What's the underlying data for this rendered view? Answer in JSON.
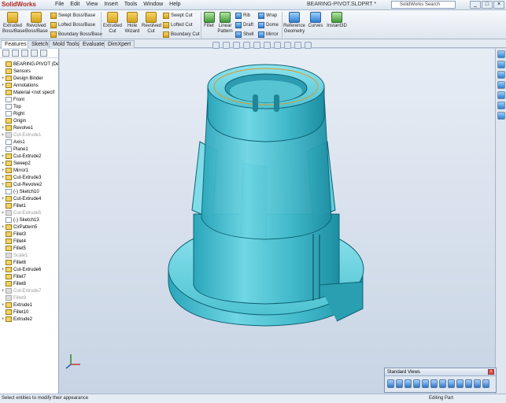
{
  "app": {
    "name": "SolidWorks",
    "filename": "BEARING-PIVOT.SLDPRT *",
    "search_placeholder": "SolidWorks Search"
  },
  "menu": [
    "File",
    "Edit",
    "View",
    "Insert",
    "Tools",
    "Window",
    "Help"
  ],
  "ribbon": {
    "extruded_boss": "Extruded Boss/Base",
    "revolved_boss": "Revolved Boss/Base",
    "swept_boss": "Swept Boss/Base",
    "lofted_boss": "Lofted Boss/Base",
    "boundary_boss": "Boundary Boss/Base",
    "extruded_cut": "Extruded Cut",
    "hole_wizard": "Hole Wizard",
    "revolved_cut": "Revolved Cut",
    "swept_cut": "Swept Cut",
    "lofted_cut": "Lofted Cut",
    "boundary_cut": "Boundary Cut",
    "fillet": "Fillet",
    "linear_pattern": "Linear Pattern",
    "rib": "Rib",
    "draft": "Draft",
    "shell": "Shell",
    "wrap": "Wrap",
    "dome": "Dome",
    "mirror": "Mirror",
    "reference_geometry": "Reference Geometry",
    "curves": "Curves",
    "instant3d": "Instant3D"
  },
  "tabs": [
    "Features",
    "Sketch",
    "Mold Tools",
    "Evaluate",
    "DimXpert"
  ],
  "tree": [
    {
      "label": "BEARING-PIVOT (Defa",
      "expand": "",
      "state": "normal"
    },
    {
      "label": "Sensors",
      "expand": "",
      "state": "normal"
    },
    {
      "label": "Design Binder",
      "expand": "+",
      "state": "normal"
    },
    {
      "label": "Annotations",
      "expand": "+",
      "state": "normal"
    },
    {
      "label": "Material <not specif",
      "expand": "",
      "state": "normal"
    },
    {
      "label": "Front",
      "expand": "",
      "state": "plane"
    },
    {
      "label": "Top",
      "expand": "",
      "state": "plane"
    },
    {
      "label": "Right",
      "expand": "",
      "state": "plane"
    },
    {
      "label": "Origin",
      "expand": "",
      "state": "normal"
    },
    {
      "label": "Revolve1",
      "expand": "+",
      "state": "normal"
    },
    {
      "label": "Cut-Extrude1",
      "expand": "+",
      "state": "grey"
    },
    {
      "label": "Axis1",
      "expand": "",
      "state": "plane"
    },
    {
      "label": "Plane1",
      "expand": "",
      "state": "plane"
    },
    {
      "label": "Cut-Extrude2",
      "expand": "+",
      "state": "normal"
    },
    {
      "label": "Sweep2",
      "expand": "+",
      "state": "normal"
    },
    {
      "label": "Mirror1",
      "expand": "+",
      "state": "normal"
    },
    {
      "label": "Cut-Extrude3",
      "expand": "+",
      "state": "normal"
    },
    {
      "label": "Cut-Revolve2",
      "expand": "+",
      "state": "normal"
    },
    {
      "label": "(-) Sketch10",
      "expand": "",
      "state": "plane"
    },
    {
      "label": "Cut-Extrude4",
      "expand": "+",
      "state": "normal"
    },
    {
      "label": "Fillet1",
      "expand": "",
      "state": "normal"
    },
    {
      "label": "Cut-Extrude5",
      "expand": "+",
      "state": "grey"
    },
    {
      "label": "(-) Sketch13",
      "expand": "",
      "state": "plane"
    },
    {
      "label": "CirPattern5",
      "expand": "+",
      "state": "normal"
    },
    {
      "label": "Fillet3",
      "expand": "",
      "state": "normal"
    },
    {
      "label": "Fillet4",
      "expand": "",
      "state": "normal"
    },
    {
      "label": "Fillet5",
      "expand": "",
      "state": "normal"
    },
    {
      "label": "Scale1",
      "expand": "",
      "state": "grey"
    },
    {
      "label": "Fillet6",
      "expand": "",
      "state": "normal"
    },
    {
      "label": "Cut-Extrude6",
      "expand": "+",
      "state": "normal"
    },
    {
      "label": "Fillet7",
      "expand": "",
      "state": "normal"
    },
    {
      "label": "Fillet8",
      "expand": "",
      "state": "normal"
    },
    {
      "label": "Cut-Extrude7",
      "expand": "+",
      "state": "grey"
    },
    {
      "label": "Fillet9",
      "expand": "",
      "state": "grey"
    },
    {
      "label": "Extrude1",
      "expand": "+",
      "state": "normal"
    },
    {
      "label": "Fillet10",
      "expand": "",
      "state": "normal"
    },
    {
      "label": "Extrude2",
      "expand": "+",
      "state": "normal"
    }
  ],
  "standard_views": {
    "title": "Standard Views"
  },
  "status": {
    "left": "Select entities to modify their appearance",
    "right": "Editing Part"
  },
  "colors": {
    "model": "#3fb7c8",
    "model_dark": "#167f92",
    "model_light": "#8fe3ee"
  }
}
